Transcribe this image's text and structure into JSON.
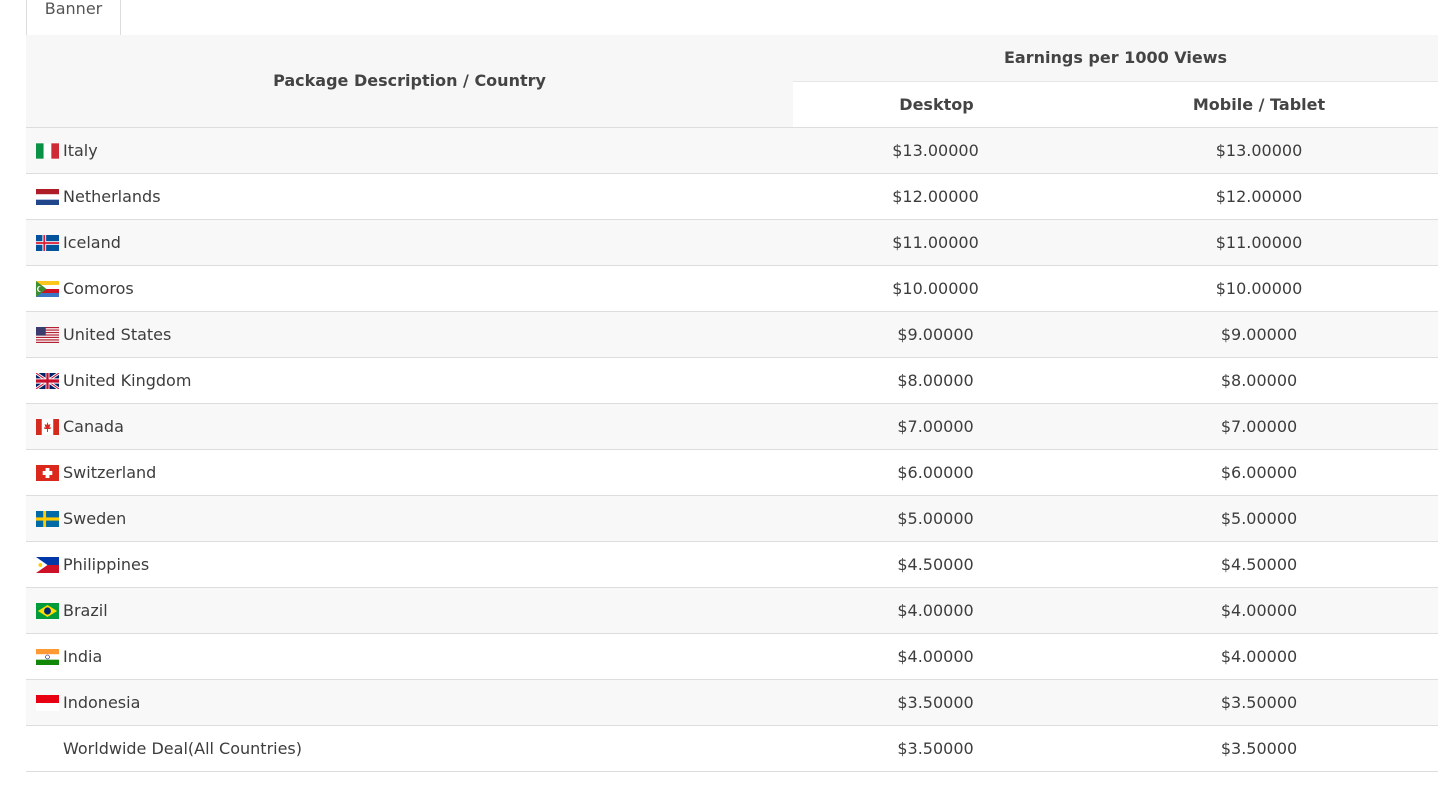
{
  "tabs": [
    {
      "label": "Banner",
      "active": true
    }
  ],
  "table": {
    "header": {
      "description": "Package Description / Country",
      "group": "Earnings per 1000 Views",
      "desktop": "Desktop",
      "mobile": "Mobile / Tablet"
    },
    "rows": [
      {
        "country": "Italy",
        "flag": "italy-flag-icon",
        "desktop": "$13.00000",
        "mobile": "$13.00000"
      },
      {
        "country": "Netherlands",
        "flag": "netherlands-flag-icon",
        "desktop": "$12.00000",
        "mobile": "$12.00000"
      },
      {
        "country": "Iceland",
        "flag": "iceland-flag-icon",
        "desktop": "$11.00000",
        "mobile": "$11.00000"
      },
      {
        "country": "Comoros",
        "flag": "comoros-flag-icon",
        "desktop": "$10.00000",
        "mobile": "$10.00000"
      },
      {
        "country": "United States",
        "flag": "united-states-flag-icon",
        "desktop": "$9.00000",
        "mobile": "$9.00000"
      },
      {
        "country": "United Kingdom",
        "flag": "united-kingdom-flag-icon",
        "desktop": "$8.00000",
        "mobile": "$8.00000"
      },
      {
        "country": "Canada",
        "flag": "canada-flag-icon",
        "desktop": "$7.00000",
        "mobile": "$7.00000"
      },
      {
        "country": "Switzerland",
        "flag": "switzerland-flag-icon",
        "desktop": "$6.00000",
        "mobile": "$6.00000"
      },
      {
        "country": "Sweden",
        "flag": "sweden-flag-icon",
        "desktop": "$5.00000",
        "mobile": "$5.00000"
      },
      {
        "country": "Philippines",
        "flag": "philippines-flag-icon",
        "desktop": "$4.50000",
        "mobile": "$4.50000"
      },
      {
        "country": "Brazil",
        "flag": "brazil-flag-icon",
        "desktop": "$4.00000",
        "mobile": "$4.00000"
      },
      {
        "country": "India",
        "flag": "india-flag-icon",
        "desktop": "$4.00000",
        "mobile": "$4.00000"
      },
      {
        "country": "Indonesia",
        "flag": "indonesia-flag-icon",
        "desktop": "$3.50000",
        "mobile": "$3.50000"
      },
      {
        "country": "Worldwide Deal(All Countries)",
        "flag": "",
        "desktop": "$3.50000",
        "mobile": "$3.50000"
      }
    ]
  },
  "colors": {
    "header_bg": "#f7f7f7",
    "stripe_bg": "#f8f8f8",
    "border": "#dddddd",
    "text": "#3d3d3d"
  }
}
